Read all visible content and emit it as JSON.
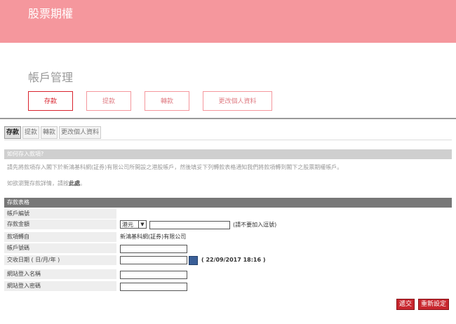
{
  "app": {
    "title": "股票期權"
  },
  "section": {
    "title": "帳戶管理"
  },
  "big_tabs": [
    "存款",
    "提款",
    "轉款",
    "更改個人資料"
  ],
  "sub_tabs": [
    "存款",
    "提款",
    "轉款",
    "更改個人資料"
  ],
  "howto": {
    "title": "如何存入款項?",
    "line1": "請先將款項存入閣下於新鴻基科網(証券)有限公司所開設之港股帳戶，然後填妥下列轉款表格通知我們將款項轉到閣下之股票期權帳戶。",
    "line2_prefix": "如欲瀏覽存款詳情，請按",
    "line2_link": "此處",
    "line2_suffix": "。"
  },
  "form": {
    "title": "存款表格",
    "labels": [
      "帳戶編號",
      "存款金額",
      "款項轉自",
      "帳戶號碼",
      "交收日期 ( 日/月/年 )",
      "網站登入名稱",
      "網站登入密碼"
    ],
    "currency_value": "港元",
    "amount_note": "(請不要加入逗號)",
    "transfer_from_value": "新鴻基科網(証券)有限公司",
    "date_note": "( 22/09/2017 18:16 )"
  },
  "buttons": {
    "submit": "遞交",
    "reset": "重新設定"
  }
}
